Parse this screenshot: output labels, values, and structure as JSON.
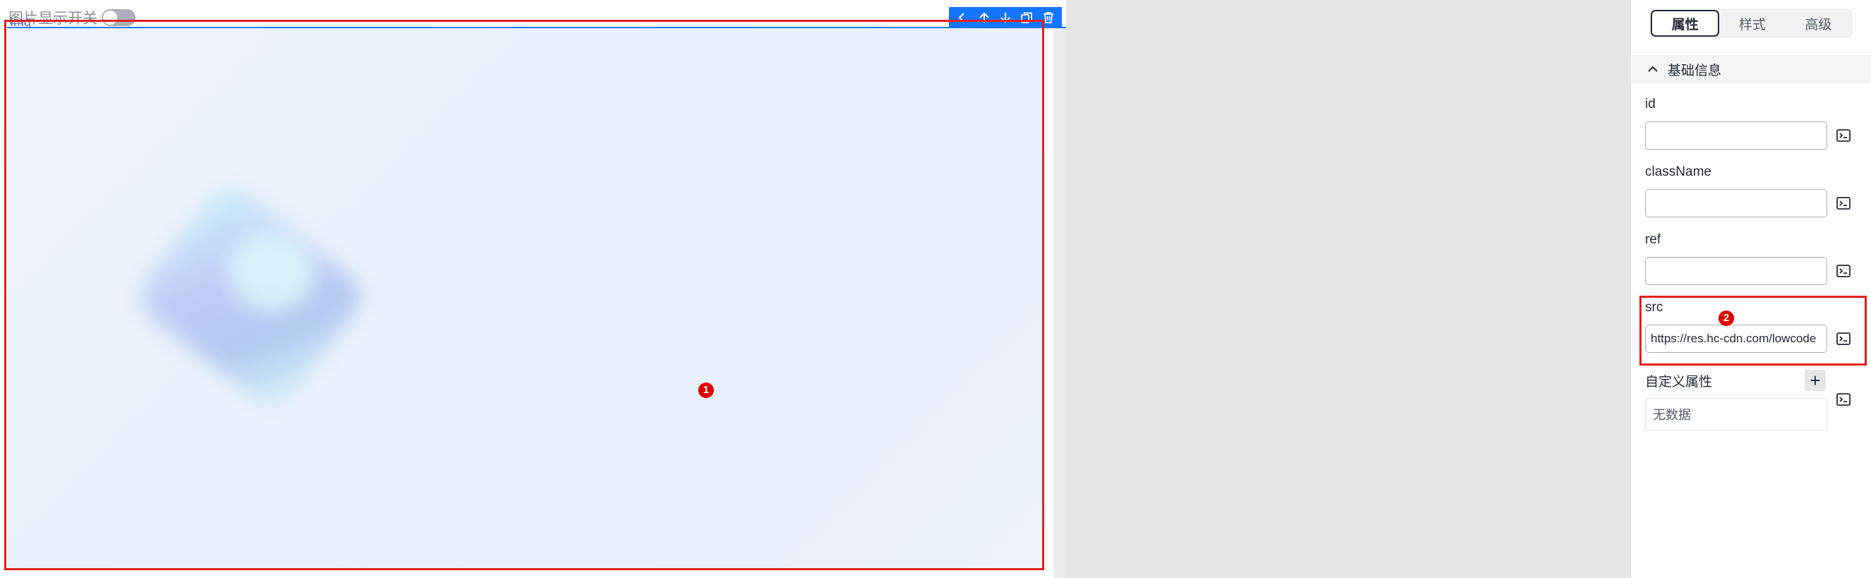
{
  "canvas": {
    "toggle_label": "图片显示开关",
    "component_tag": "Img",
    "toolbar": {
      "select_parent_icon": "chevron-left-icon",
      "move_up_icon": "arrow-up-icon",
      "move_down_icon": "arrow-down-icon",
      "copy_icon": "copy-icon",
      "delete_icon": "trash-icon"
    }
  },
  "annotations": {
    "marker_1": "1",
    "marker_2": "2"
  },
  "panel": {
    "tabs": [
      {
        "label": "属性",
        "active": true
      },
      {
        "label": "样式",
        "active": false
      },
      {
        "label": "高级",
        "active": false
      }
    ],
    "section": {
      "title": "基础信息",
      "expanded": true
    },
    "fields": [
      {
        "label": "id",
        "value": ""
      },
      {
        "label": "className",
        "value": ""
      },
      {
        "label": "ref",
        "value": ""
      },
      {
        "label": "src",
        "value": "https://res.hc-cdn.com/lowcode"
      }
    ],
    "custom_attrs": {
      "label": "自定义属性",
      "add_label": "+",
      "empty_text": "无数据"
    }
  },
  "colors": {
    "accent": "#1476ff",
    "annotation_red": "#e02020",
    "image_bg": "#eaf1fc"
  }
}
